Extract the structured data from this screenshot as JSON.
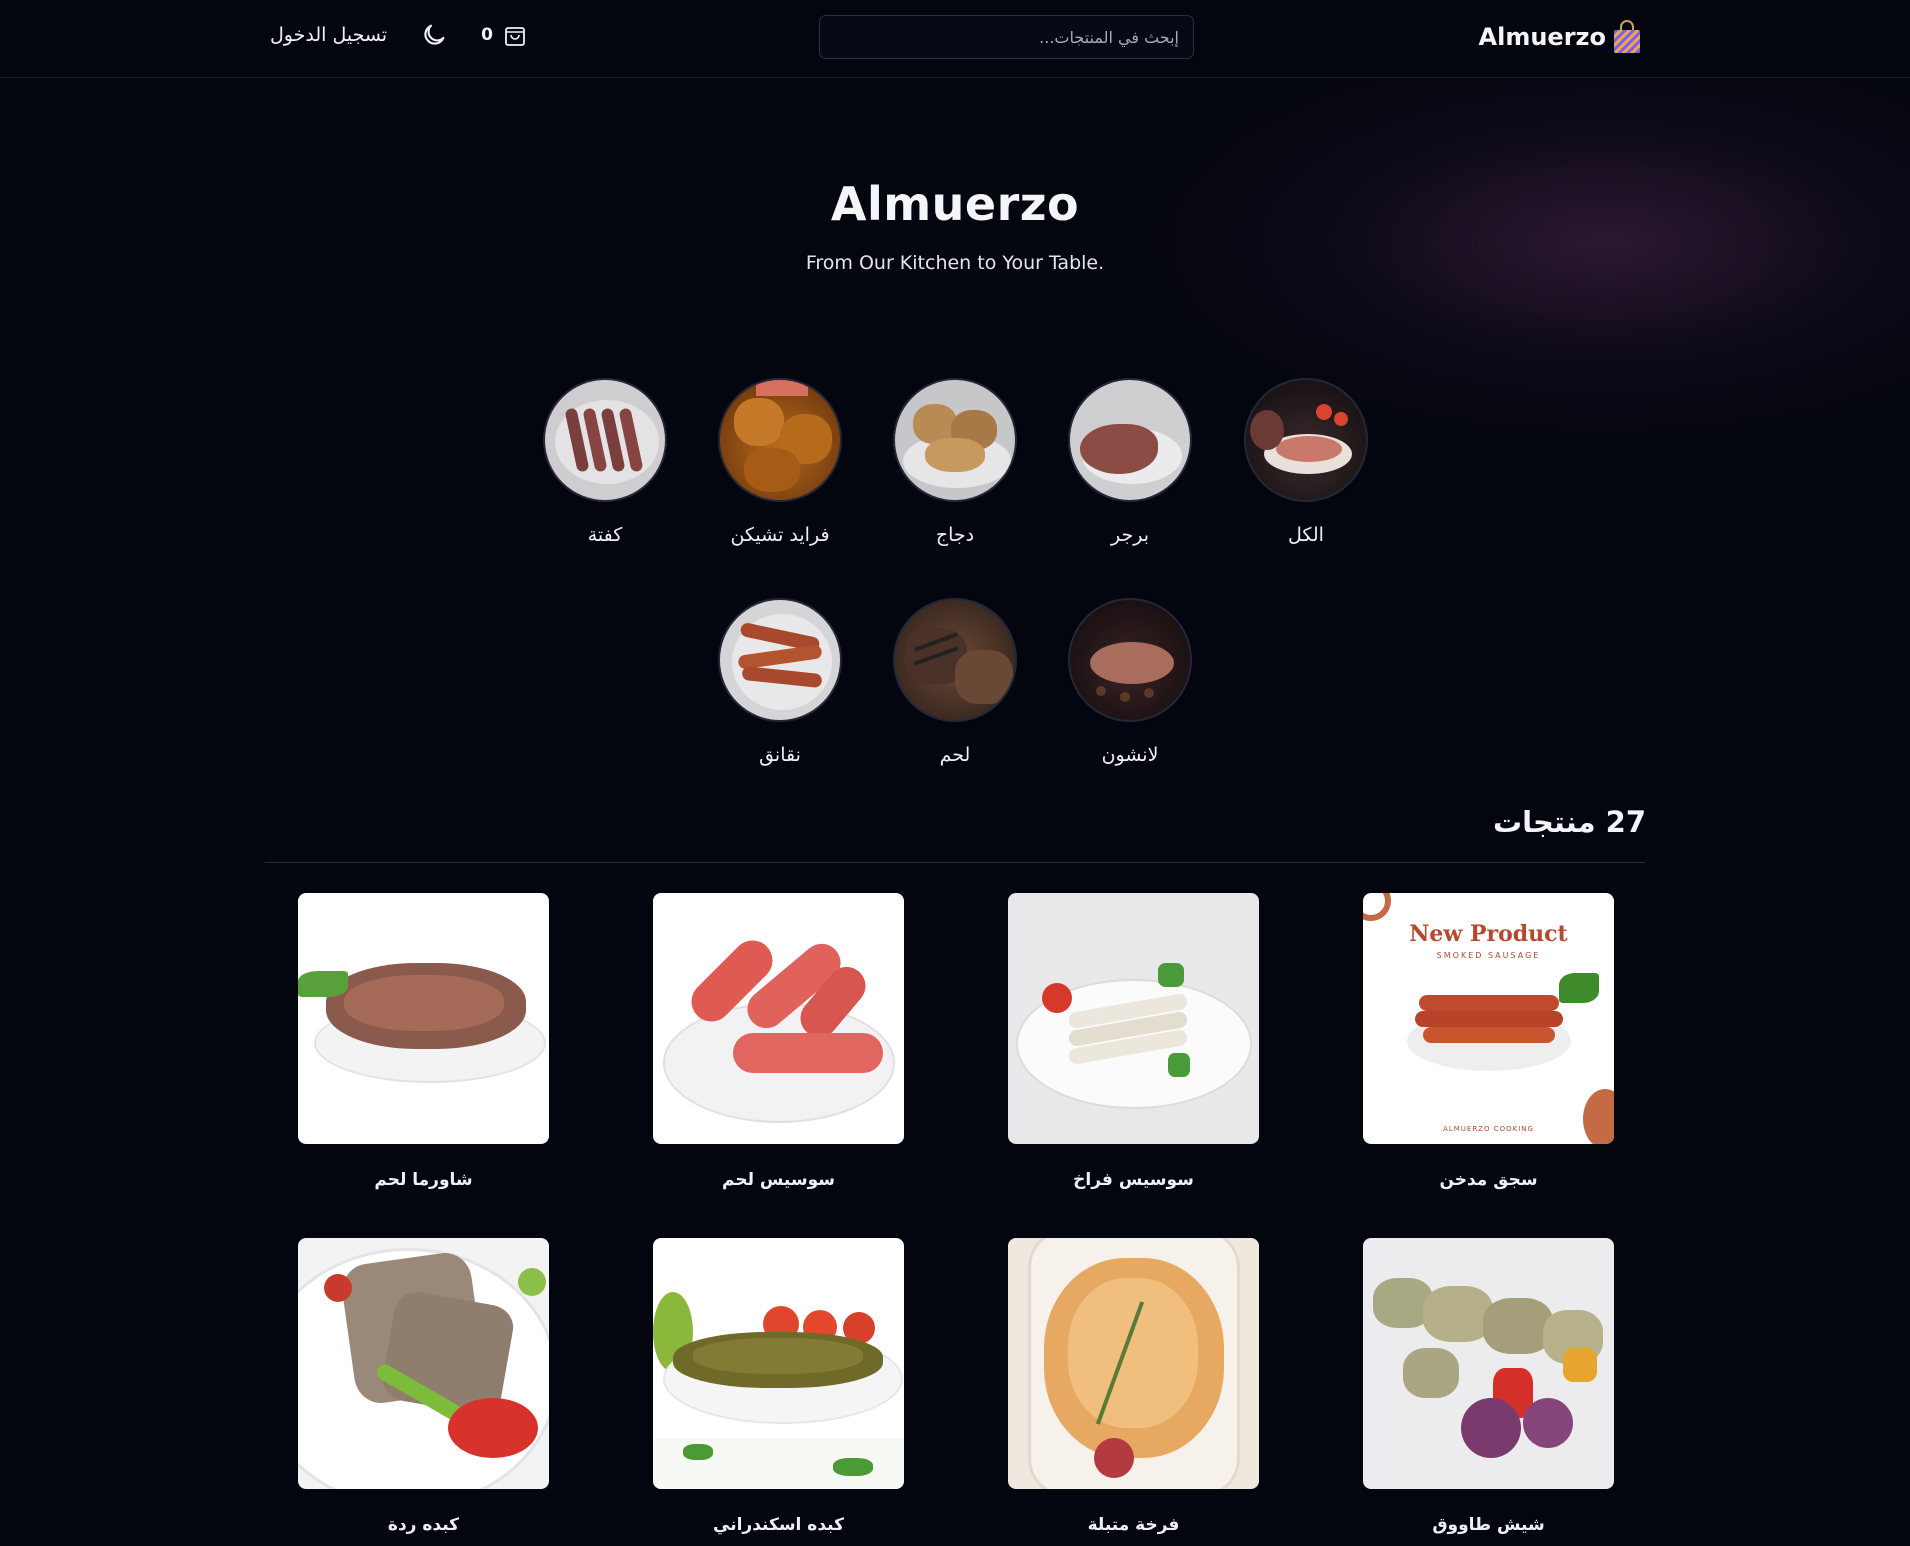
{
  "header": {
    "brand": "Almuerzo",
    "search_placeholder": "إبحث في المنتجات...",
    "cart_count": "0",
    "login_label": "تسجيل الدخول"
  },
  "hero": {
    "title": "Almuerzo",
    "subtitle": "From Our Kitchen to Your Table."
  },
  "categories": [
    {
      "label": "الكل"
    },
    {
      "label": "برجر"
    },
    {
      "label": "دجاج"
    },
    {
      "label": "فرايد تشيكن"
    },
    {
      "label": "كفتة"
    },
    {
      "label": "لانشون"
    },
    {
      "label": "لحم"
    },
    {
      "label": "نقانق"
    }
  ],
  "products_heading": "27 منتجات",
  "products": [
    {
      "name": "سجق مدخن",
      "promo_title": "New Product",
      "promo_sub": "SMOKED SAUSAGE",
      "promo_footer": "ALMUERZO COOKING"
    },
    {
      "name": "سوسيس فراخ"
    },
    {
      "name": "سوسيس لحم"
    },
    {
      "name": "شاورما لحم"
    },
    {
      "name": "شيش طاووق"
    },
    {
      "name": "فرخة متبلة"
    },
    {
      "name": "كبده اسكندراني"
    },
    {
      "name": "كبده ردة"
    }
  ],
  "colors": {
    "background": "#04060f",
    "text": "#f4f5f8",
    "border": "#262b3a"
  }
}
